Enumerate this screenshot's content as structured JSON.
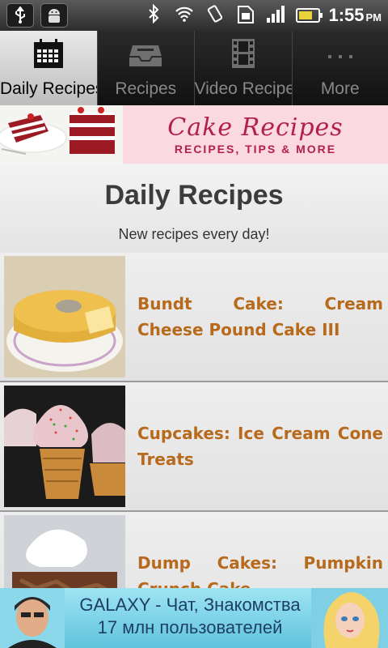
{
  "status_bar": {
    "time": "1:55",
    "ampm": "PM",
    "left_icons": [
      "usb-icon",
      "android-debug-icon"
    ],
    "right_icons": [
      "bluetooth-icon",
      "wifi-icon",
      "vibrate-icon",
      "sim-icon",
      "signal-icon",
      "battery-charging-icon"
    ]
  },
  "tabs": [
    {
      "label": "Daily Recipes",
      "icon": "calendar-icon",
      "active": true
    },
    {
      "label": "Recipes",
      "icon": "inbox-icon",
      "active": false
    },
    {
      "label": "Video Recipe",
      "icon": "film-icon",
      "active": false
    },
    {
      "label": "More",
      "icon": "more-icon",
      "active": false
    }
  ],
  "banner": {
    "title": "Cake Recipes",
    "subtitle": "RECIPES, TIPS & MORE"
  },
  "header": {
    "title": "Daily Recipes",
    "subtitle": "New recipes every day!"
  },
  "recipes": [
    {
      "title": "Bundt Cake: Cream Cheese Pound Cake III"
    },
    {
      "title": "Cupcakes: Ice Cream Cone Treats"
    },
    {
      "title": "Dump Cakes: Pumpkin Crunch Cake"
    }
  ],
  "ad": {
    "line1": "GALAXY - Чат, Знакомства",
    "line2": "17 млн пользователей"
  },
  "colors": {
    "recipe_title": "#b86a1c",
    "banner_accent": "#b21f4a",
    "ad_background": "#7fd3e8"
  }
}
